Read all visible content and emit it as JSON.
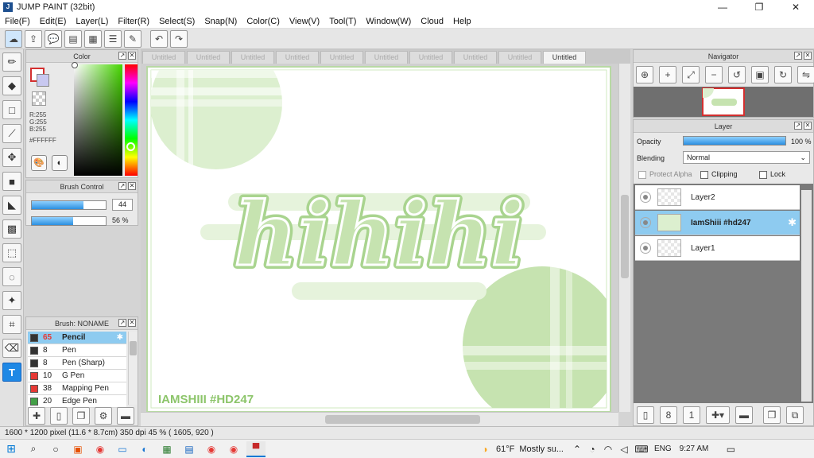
{
  "app": {
    "title": "JUMP PAINT (32bit)"
  },
  "window_controls": {
    "minimize": "—",
    "maximize": "❐",
    "close": "✕"
  },
  "menu": [
    "File(F)",
    "Edit(E)",
    "Layer(L)",
    "Filter(R)",
    "Select(S)",
    "Snap(N)",
    "Color(C)",
    "View(V)",
    "Tool(T)",
    "Window(W)",
    "Cloud",
    "Help"
  ],
  "tabs": [
    "Untitled",
    "Untitled",
    "Untitled",
    "Untitled",
    "Untitled",
    "Untitled",
    "Untitled",
    "Untitled",
    "Untitled",
    "Untitled"
  ],
  "color_panel": {
    "title": "Color",
    "r": "R:255",
    "g": "G:255",
    "b": "B:255",
    "hex": "#FFFFFF",
    "main_color": "#ffffff",
    "accent_color": "#d32f2f"
  },
  "brush_control": {
    "title": "Brush Control",
    "size_value": "44",
    "size_fill": 0.7,
    "opacity_value": "56 %",
    "opacity_fill": 0.56
  },
  "brush_list": {
    "title": "Brush: NONAME",
    "items": [
      {
        "size": "65",
        "name": "Pencil",
        "color": "#333333",
        "active": true
      },
      {
        "size": "8",
        "name": "Pen",
        "color": "#333333"
      },
      {
        "size": "8",
        "name": "Pen (Sharp)",
        "color": "#333333"
      },
      {
        "size": "10",
        "name": "G Pen",
        "color": "#e53935"
      },
      {
        "size": "38",
        "name": "Mapping Pen",
        "color": "#e53935"
      },
      {
        "size": "20",
        "name": "Edge Pen",
        "color": "#43a047"
      }
    ]
  },
  "artwork": {
    "main_text": "hihihi",
    "signature": "IAMSHIII #HD247",
    "green": "#c6e3b0",
    "light_green": "#dcefcf",
    "dark_green": "#7cbf5a"
  },
  "navigator": {
    "title": "Navigator"
  },
  "layer_panel": {
    "title": "Layer",
    "opacity_label": "Opacity",
    "opacity_value": "100 %",
    "opacity_fill": 1.0,
    "blending_label": "Blending",
    "blending_value": "Normal",
    "protect_alpha": "Protect Alpha",
    "clipping": "Clipping",
    "lock": "Lock",
    "layers": [
      {
        "name": "Layer2",
        "active": false
      },
      {
        "name": "IamShiii #hd247",
        "active": true
      },
      {
        "name": "Layer1",
        "active": false
      }
    ]
  },
  "status": {
    "text": "1600 * 1200 pixel  (11.6 * 8.7cm)  350 dpi  45 %  ( 1605, 920 )"
  },
  "taskbar": {
    "weather_temp": "61°F",
    "weather_desc": "Mostly su...",
    "lang": "ENG",
    "time": "9:27 AM"
  }
}
